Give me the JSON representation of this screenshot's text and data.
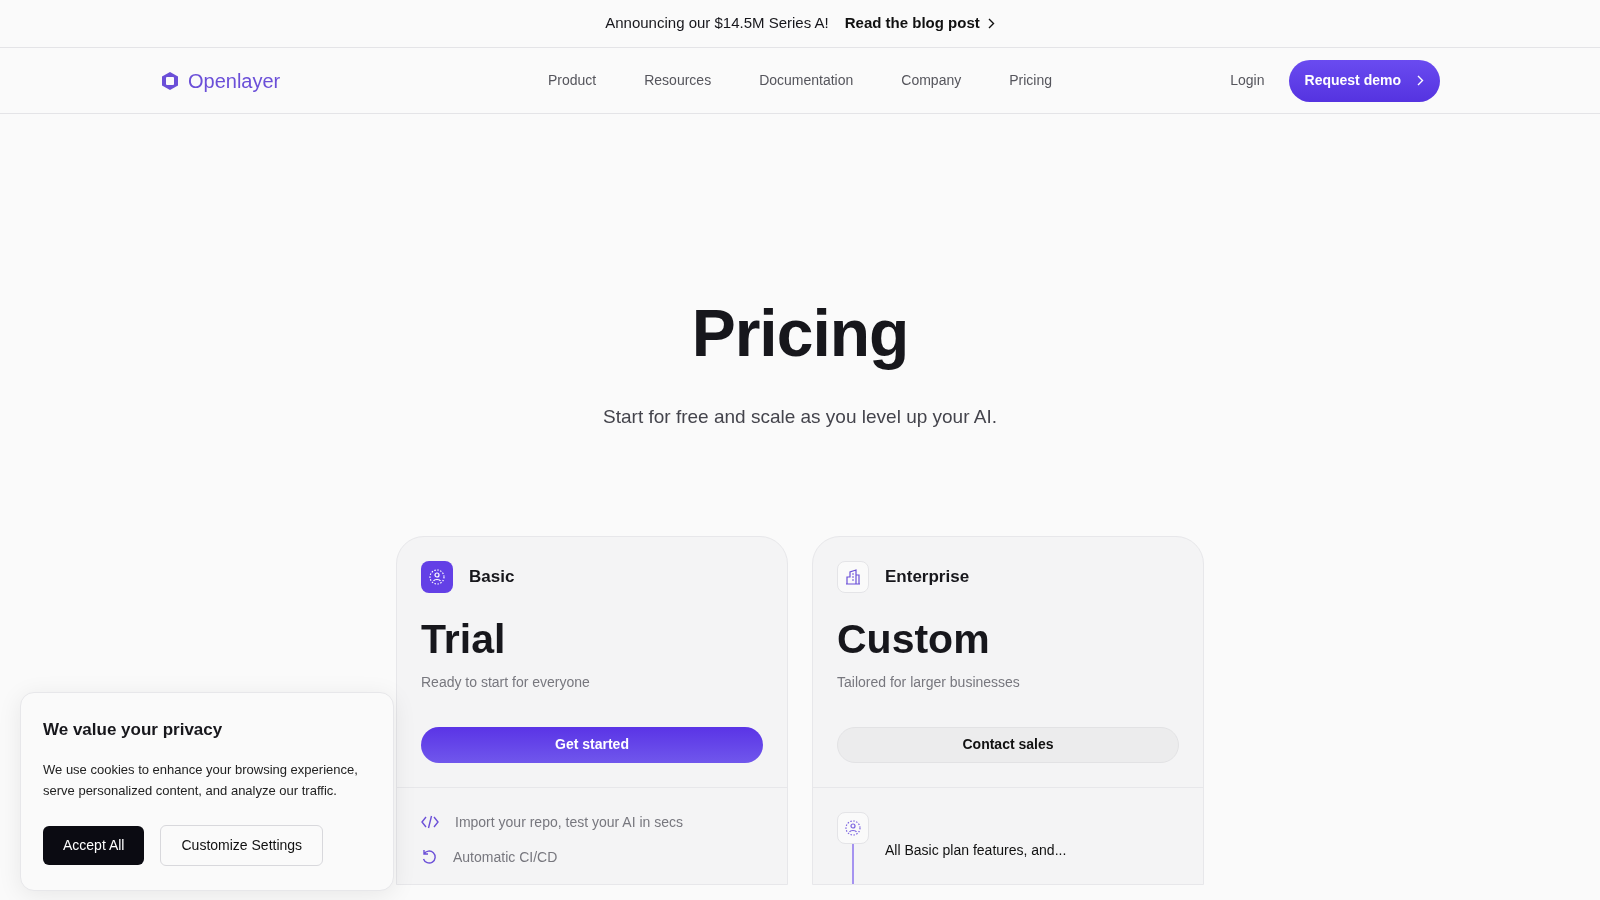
{
  "announcement": {
    "text": "Announcing our $14.5M Series A!",
    "link": "Read the blog post"
  },
  "navbar": {
    "logo": "Openlayer",
    "links": [
      "Product",
      "Resources",
      "Documentation",
      "Company",
      "Pricing"
    ],
    "login": "Login",
    "cta": "Request demo"
  },
  "hero": {
    "title": "Pricing",
    "subtitle": "Start for free and scale as you level up your AI."
  },
  "plans": [
    {
      "kind": "basic",
      "name": "Basic",
      "price": "Trial",
      "description": "Ready to start for everyone",
      "button": "Get started",
      "features": [
        {
          "kind": "code",
          "text": "Import your repo, test your AI in secs"
        },
        {
          "kind": "refresh",
          "text": "Automatic CI/CD"
        }
      ]
    },
    {
      "kind": "enterprise",
      "name": "Enterprise",
      "price": "Custom",
      "description": "Tailored for larger businesses",
      "button": "Contact sales",
      "features": [
        {
          "kind": "person",
          "text": "All Basic plan features, and..."
        }
      ]
    }
  ],
  "cookie_banner": {
    "title": "We value your privacy",
    "text": "We use cookies to enhance your browsing experience, serve personalized content, and analyze our traffic.",
    "accept": "Accept All",
    "customize": "Customize Settings"
  }
}
